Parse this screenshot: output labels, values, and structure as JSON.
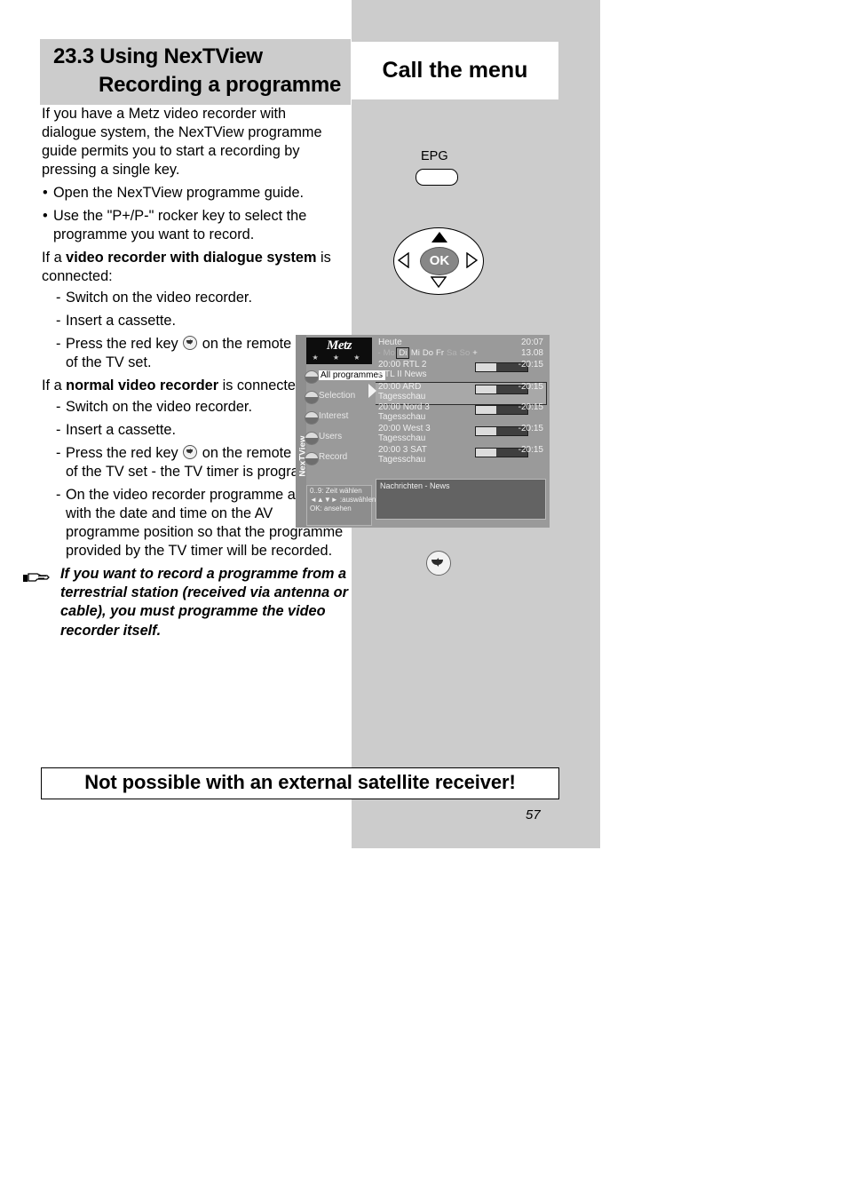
{
  "section": {
    "number_title": "23.3 Using NexTView",
    "subtitle": "Recording a programme"
  },
  "body": {
    "intro": "If you have a Metz video recorder with dialogue system, the NexTView programme guide permits you to start a recording by pressing a single key.",
    "bullet1": "Open the NexTView programme guide.",
    "bullet2": "Use the \"P+/P-\" rocker key to select the programme you want to record.",
    "cond1_pre": "If a ",
    "cond1_bold": "video recorder with dialogue system",
    "cond1_post": " is connected:",
    "c1_step1": "Switch on the video recorder.",
    "c1_step2": "Insert a cassette.",
    "c1_step3_pre": "Press the red key",
    "c1_step3_post": "on the remote control of the TV set.",
    "cond2_pre": "If a ",
    "cond2_bold": "normal video recorder",
    "cond2_post": " is connected:",
    "c2_step1": "Switch on the video recorder.",
    "c2_step2": "Insert a cassette.",
    "c2_step3_pre": "Press the red key",
    "c2_step3_post": "on the remote control of the TV set - the TV timer is programmed.",
    "c2_step4": "On the video recorder programme a timer with the date and time on the AV programme position so that the programme provided by the TV timer will be recorded."
  },
  "note": {
    "icon": "pointing-hand-icon",
    "text": "If you want to record a programme from a terrestrial station (received via antenna or cable), you must programme the video recorder itself."
  },
  "banner": {
    "text": "Not possible with an external satellite receiver!"
  },
  "page_number": "57",
  "right": {
    "heading": "Call the menu",
    "epg_key_label": "EPG",
    "ok_label": "OK",
    "back_key": "back-arrow-icon"
  },
  "tv_screen": {
    "spine_label": "NexTView",
    "logo": {
      "brand": "Metz",
      "stars": "★ ★ ★"
    },
    "menu_items": [
      {
        "label": "All programmes",
        "selected": true
      },
      {
        "label": "Selection",
        "selected": false
      },
      {
        "label": "Interest",
        "selected": false
      },
      {
        "label": "Users",
        "selected": false
      },
      {
        "label": "Record",
        "selected": false
      }
    ],
    "hints": [
      "0..9: Zeit wählen",
      "◄▲▼► :auswählen",
      "OK: ansehen"
    ],
    "header": {
      "today": "Heute",
      "clock": "20:07",
      "date": "13.08",
      "days": [
        {
          "label": "-",
          "state": "dim"
        },
        {
          "label": "Mo",
          "state": "dim"
        },
        {
          "label": "Di",
          "state": "current"
        },
        {
          "label": "Mi",
          "state": "normal"
        },
        {
          "label": "Do",
          "state": "normal"
        },
        {
          "label": "Fr",
          "state": "normal"
        },
        {
          "label": "Sa",
          "state": "dim"
        },
        {
          "label": "So",
          "state": "dim"
        },
        {
          "label": "+",
          "state": "normal"
        }
      ]
    },
    "programmes": [
      {
        "time": "20:00",
        "channel": "RTL 2",
        "title": "RTL II News",
        "end": "-20:15",
        "progress": 40,
        "highlighted": false
      },
      {
        "time": "20:00",
        "channel": "ARD",
        "title": "Tagesschau",
        "end": "-20:15",
        "progress": 40,
        "highlighted": true
      },
      {
        "time": "20:00",
        "channel": "Nord 3",
        "title": "Tagesschau",
        "end": "-20:15",
        "progress": 40,
        "highlighted": false
      },
      {
        "time": "20:00",
        "channel": "West 3",
        "title": "Tagesschau",
        "end": "-20:15",
        "progress": 40,
        "highlighted": false
      },
      {
        "time": "20:00",
        "channel": "3 SAT",
        "title": "Tagesschau",
        "end": "-20:15",
        "progress": 40,
        "highlighted": false
      }
    ],
    "info_text": "Nachrichten - News"
  },
  "colors": {
    "panel_grey": "#cccccc",
    "tv_bg": "#9a9a9a",
    "tv_info": "#636363",
    "highlight": "#a8a8a8"
  }
}
